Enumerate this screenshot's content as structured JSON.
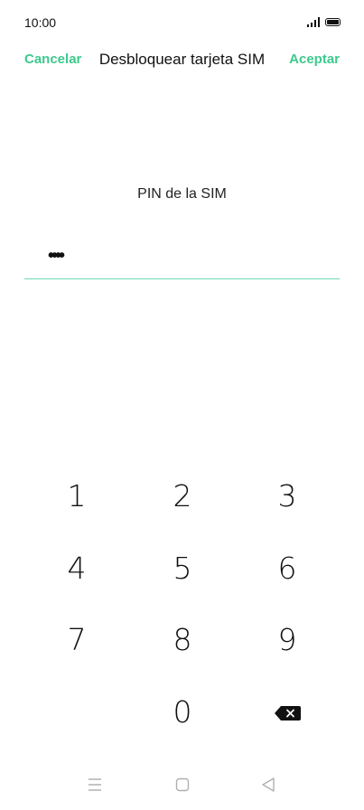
{
  "status_bar": {
    "time": "10:00",
    "icons": [
      "signal-icon",
      "battery-icon"
    ]
  },
  "header": {
    "cancel_label": "Cancelar",
    "title": "Desbloquear tarjeta SIM",
    "accept_label": "Aceptar"
  },
  "pin": {
    "label": "PIN de la SIM",
    "value": "••••"
  },
  "keypad": {
    "keys": [
      "1",
      "2",
      "3",
      "4",
      "5",
      "6",
      "7",
      "8",
      "9",
      "0"
    ],
    "backspace_icon": "backspace-icon"
  },
  "nav_bar": {
    "icons": [
      "menu-icon",
      "home-icon",
      "back-icon"
    ]
  },
  "colors": {
    "accent": "#3ec98d",
    "underline": "#6fd8ba",
    "text": "#111111",
    "nav_icon": "#b0b0b0"
  }
}
